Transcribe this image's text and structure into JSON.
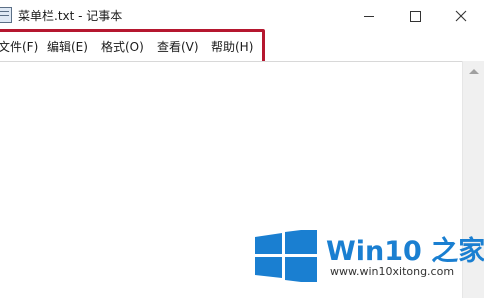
{
  "window": {
    "title": "菜单栏.txt - 记事本",
    "controls": {
      "minimize": "minimize",
      "maximize": "maximize",
      "close": "close"
    }
  },
  "menubar": {
    "items": [
      {
        "label": "文件(F)"
      },
      {
        "label": "编辑(E)"
      },
      {
        "label": "格式(O)"
      },
      {
        "label": "查看(V)"
      },
      {
        "label": "帮助(H)"
      }
    ],
    "highlight_color": "#b5172f"
  },
  "editor": {
    "content": ""
  },
  "watermark": {
    "brand": "Win10 之家",
    "url": "www.win10xitong.com",
    "logo_color": "#1a7fd1"
  }
}
